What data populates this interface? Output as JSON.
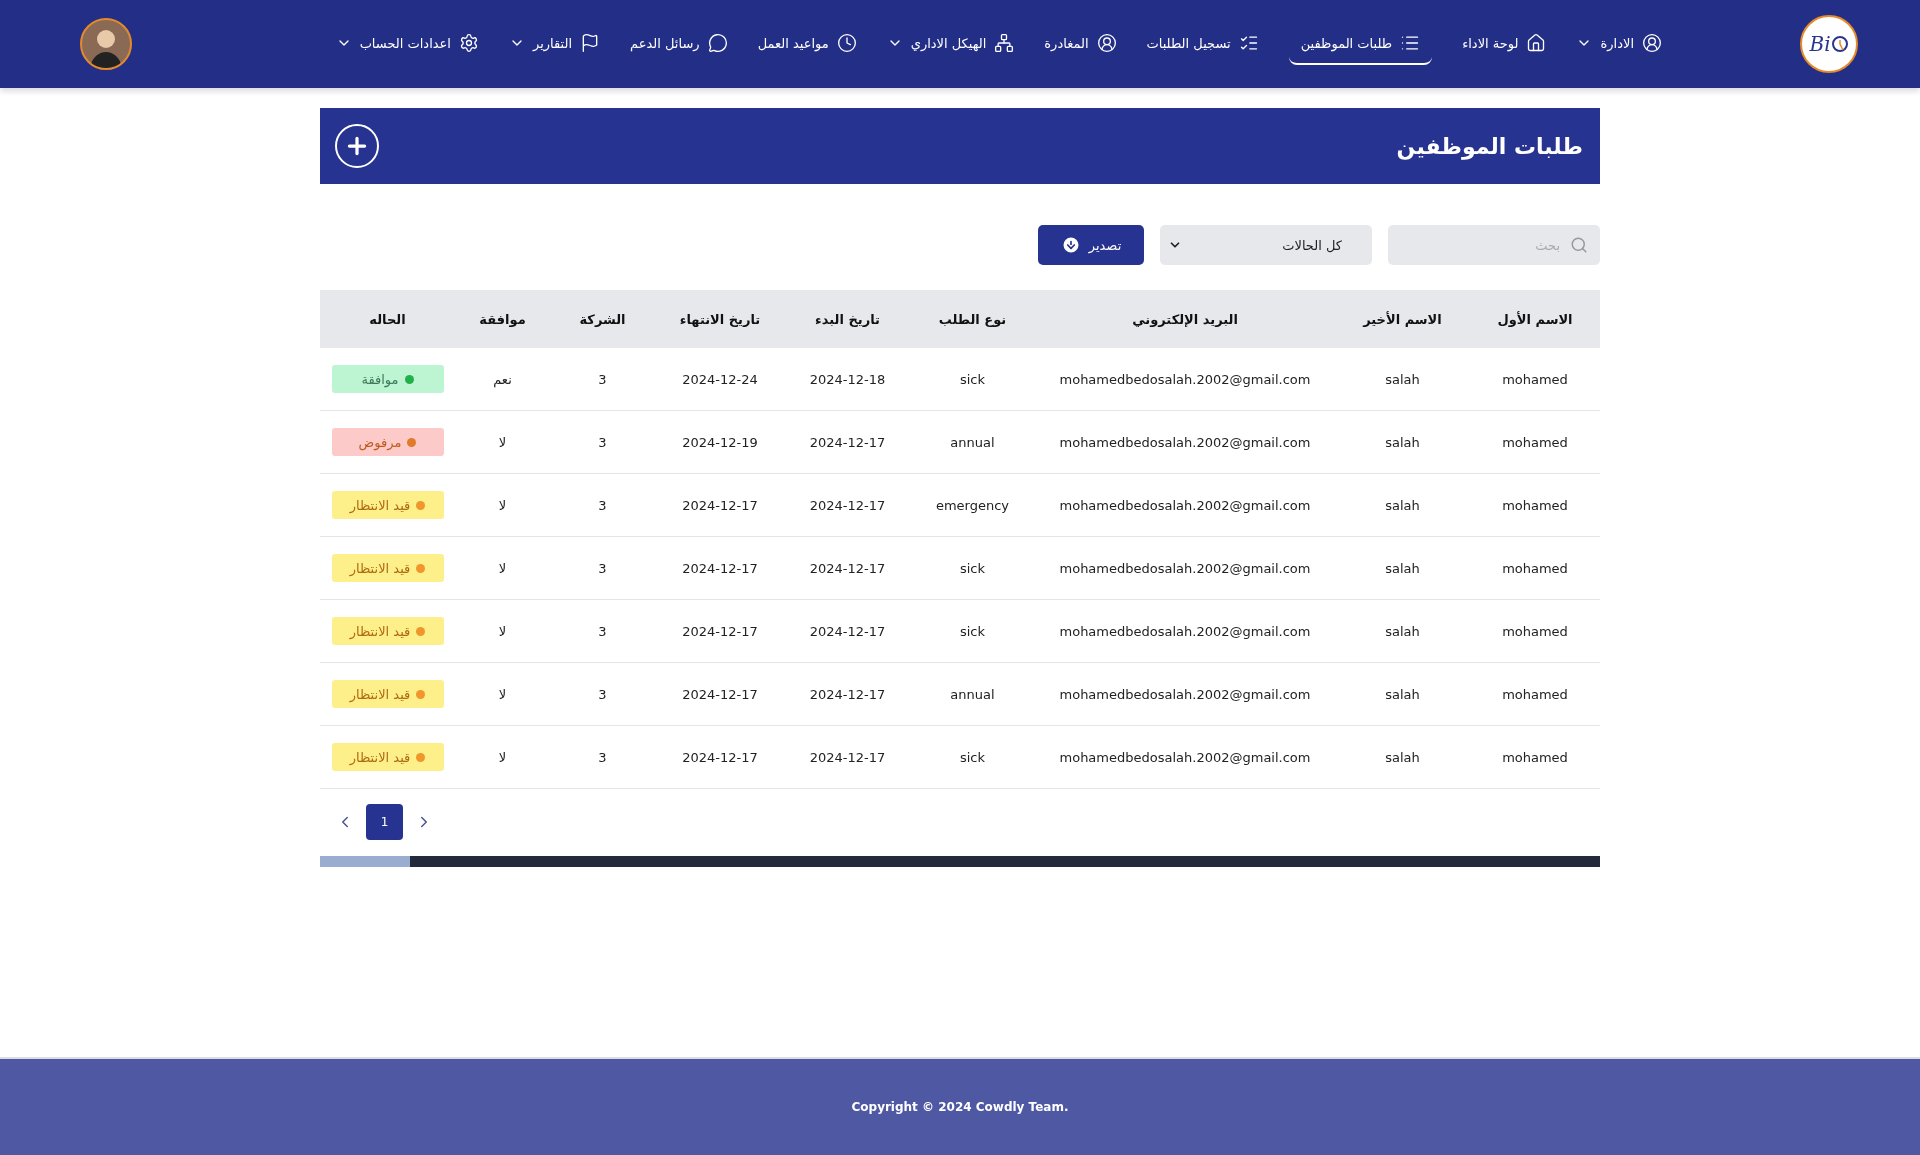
{
  "nav": {
    "logo": "Bi",
    "items": [
      {
        "label": "الادارة",
        "dropdown": true,
        "selected": false
      },
      {
        "label": "لوحة الاداء",
        "dropdown": false,
        "selected": false
      },
      {
        "label": "طلبات الموظفين",
        "dropdown": false,
        "selected": true
      },
      {
        "label": "تسجيل الطلبات",
        "dropdown": false,
        "selected": false
      },
      {
        "label": "المغادرة",
        "dropdown": false,
        "selected": false
      },
      {
        "label": "الهيكل الاداري",
        "dropdown": true,
        "selected": false
      },
      {
        "label": "مواعيد العمل",
        "dropdown": false,
        "selected": false
      },
      {
        "label": "رسائل الدعم",
        "dropdown": false,
        "selected": false
      },
      {
        "label": "التقارير",
        "dropdown": true,
        "selected": false
      },
      {
        "label": "اعدادات الحساب",
        "dropdown": true,
        "selected": false
      }
    ]
  },
  "page": {
    "title": "طلبات الموظفين"
  },
  "toolbar": {
    "search": {
      "placeholder": "بحث"
    },
    "filter": {
      "value": "كل الحالات"
    },
    "export": "تصدير"
  },
  "table": {
    "columns": [
      "الاسم الأول",
      "الاسم الأخير",
      "البريد الإلكتروني",
      "نوع الطلب",
      "تاريخ البدء",
      "تاريخ الانتهاء",
      "الشركة",
      "موافقة",
      "الحاله"
    ],
    "rows": [
      {
        "cells": [
          "mohamed",
          "salah",
          "mohamedbedosalah.2002@gmail.com",
          "sick",
          "2024-12-18",
          "2024-12-24",
          "3",
          "نعم"
        ],
        "status": {
          "label": "موافقة",
          "kind": "approved",
          "color": "#22b04b"
        }
      },
      {
        "cells": [
          "mohamed",
          "salah",
          "mohamedbedosalah.2002@gmail.com",
          "annual",
          "2024-12-17",
          "2024-12-19",
          "3",
          "لا"
        ],
        "status": {
          "label": "مرفوض",
          "kind": "rejected",
          "color": "#e07b2a"
        }
      },
      {
        "cells": [
          "mohamed",
          "salah",
          "mohamedbedosalah.2002@gmail.com",
          "emergency",
          "2024-12-17",
          "2024-12-17",
          "3",
          "لا"
        ],
        "status": {
          "label": "قيد الانتظار",
          "kind": "pending",
          "color": "#f0962a"
        }
      },
      {
        "cells": [
          "mohamed",
          "salah",
          "mohamedbedosalah.2002@gmail.com",
          "sick",
          "2024-12-17",
          "2024-12-17",
          "3",
          "لا"
        ],
        "status": {
          "label": "قيد الانتظار",
          "kind": "pending",
          "color": "#f0962a"
        }
      },
      {
        "cells": [
          "mohamed",
          "salah",
          "mohamedbedosalah.2002@gmail.com",
          "sick",
          "2024-12-17",
          "2024-12-17",
          "3",
          "لا"
        ],
        "status": {
          "label": "قيد الانتظار",
          "kind": "pending",
          "color": "#f0962a"
        }
      },
      {
        "cells": [
          "mohamed",
          "salah",
          "mohamedbedosalah.2002@gmail.com",
          "annual",
          "2024-12-17",
          "2024-12-17",
          "3",
          "لا"
        ],
        "status": {
          "label": "قيد الانتظار",
          "kind": "pending",
          "color": "#f0962a"
        }
      },
      {
        "cells": [
          "mohamed",
          "salah",
          "mohamedbedosalah.2002@gmail.com",
          "sick",
          "2024-12-17",
          "2024-12-17",
          "3",
          "لا"
        ],
        "status": {
          "label": "قيد الانتظار",
          "kind": "pending",
          "color": "#f0962a"
        }
      }
    ]
  },
  "pagination": {
    "pages": [
      {
        "label": "1",
        "selected": true
      }
    ]
  },
  "footer": {
    "copyright": "Copyright © 2024 Cowdly Team."
  }
}
